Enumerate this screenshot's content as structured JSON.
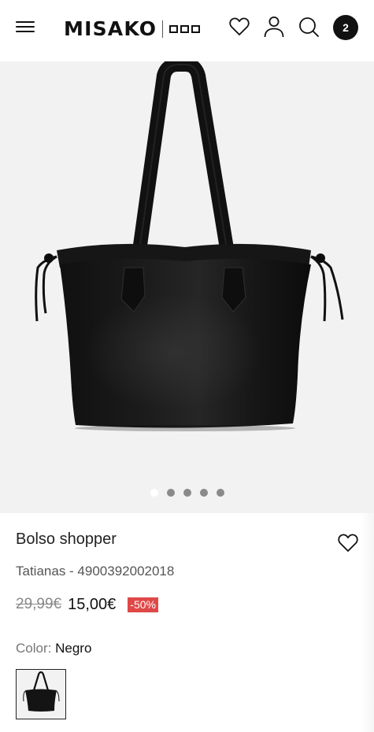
{
  "header": {
    "logo_text": "MISAKO",
    "cart_count": "2",
    "icons": [
      "menu-icon",
      "heart-icon",
      "user-icon",
      "search-icon"
    ]
  },
  "gallery": {
    "image": "black-tote-bag",
    "slides": 5,
    "active_slide": 1
  },
  "product": {
    "name": "Bolso shopper",
    "subtitle": "Tatianas - 4900392002018",
    "old_price": "29,99€",
    "new_price": "15,00€",
    "discount": "-50%",
    "color_label": "Color:",
    "color_value": "Negro"
  },
  "colors": {
    "discount_bg": "#e04848",
    "gallery_bg": "#f2f2f2",
    "text": "#111111"
  }
}
